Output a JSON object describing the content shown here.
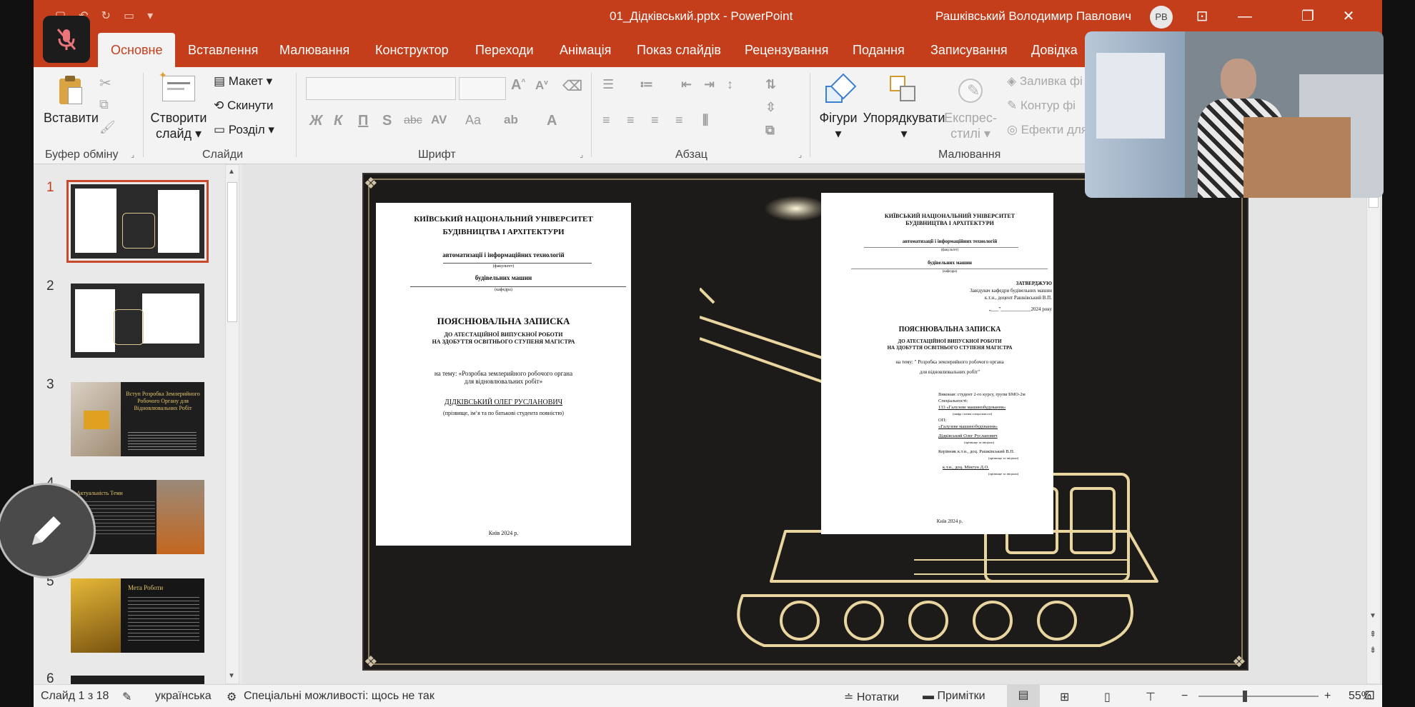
{
  "titlebar": {
    "doc_title": "01_Дідківський.pptx  -  PowerPoint",
    "user_name": "Рашківський Володимир Павлович",
    "user_initials": "PB"
  },
  "tabs": [
    "Основне",
    "Вставлення",
    "Малювання",
    "Конструктор",
    "Переходи",
    "Анімація",
    "Показ слайдів",
    "Рецензування",
    "Подання",
    "Записування",
    "Довідка"
  ],
  "ribbon": {
    "paste": "Вставити",
    "new_slide_1": "Створити",
    "new_slide_2": "слайд",
    "layout": "Макет",
    "reset": "Скинути",
    "section": "Розділ",
    "shapes": "Фігури",
    "arrange": "Упорядкувати",
    "express_1": "Експрес-",
    "express_2": "стилі",
    "fill": "Заливка фі",
    "outline": "Контур фі",
    "effects": "Ефекти для",
    "bold": "Ж",
    "italic": "К",
    "underline": "П",
    "strike": "S",
    "abc": "abc",
    "av": "AV",
    "aa": "Aa",
    "groups": {
      "clipboard": "Буфер обміну",
      "slides": "Слайди",
      "font": "Шрифт",
      "paragraph": "Абзац",
      "drawing": "Малювання"
    }
  },
  "thumbnails": [
    {
      "num": "1",
      "title": ""
    },
    {
      "num": "2",
      "title": ""
    },
    {
      "num": "3",
      "title": "Вступ Розробка Землерийного Робочого Органу для Відновлювальних Робіт"
    },
    {
      "num": "4",
      "title": "Актуальність Теми"
    },
    {
      "num": "5",
      "title": "Мета Роботи"
    },
    {
      "num": "6",
      "title": ""
    }
  ],
  "slide_left_page": {
    "uni_1": "КИЇВСЬКИЙ НАЦІОНАЛЬНИЙ УНІВЕРСИТЕТ",
    "uni_2": "БУДІВНИЦТВА І АРХІТЕКТУРИ",
    "faculty": "автоматизації і інформаційних технологій",
    "faculty_cap": "(факультет)",
    "dept": "будівельних машин",
    "dept_cap": "(кафедра)",
    "title": "ПОЯСНЮВАЛЬНА ЗАПИСКА",
    "sub_1": "ДО АТЕСТАЦІЙНОЇ ВИПУСКНОЇ РОБОТИ",
    "sub_2": "НА ЗДОБУТТЯ ОСВІТНЬОГО СТУПЕНЯ МАГІСТРА",
    "topic_1": "на тему: «Розробка землерийного робочого органа",
    "topic_2": "для відновлювальних робіт»",
    "author": "ДІДКІВСЬКИЙ ОЛЕГ РУСЛАНОВИЧ",
    "author_cap": "(прізвище, ім’я та по батькові студента повністю)",
    "footer": "Київ 2024 р."
  },
  "slide_right_page": {
    "uni_1": "КИЇВСЬКИЙ НАЦІОНАЛЬНИЙ УНІВЕРСИТЕТ",
    "uni_2": "БУДІВНИЦТВА І АРХІТЕКТУРИ",
    "faculty": "автоматизації і інформаційних технологій",
    "faculty_cap": "(факультет)",
    "dept": "будівельних машин",
    "dept_cap": "(кафедра)",
    "approve": "ЗАТВЕРДЖУЮ",
    "approve_2": "Завідувач кафедри будівельних машин",
    "approve_3": "к.т.н., доцент Рашківський В.П.",
    "approve_4": "„___”____________2024 року",
    "title": "ПОЯСНЮВАЛЬНА ЗАПИСКА",
    "sub_1": "ДО АТЕСТАЦІЙНОЇ ВИПУСКНОЇ РОБОТИ",
    "sub_2": "НА ЗДОБУТТЯ ОСВІТНЬОГО СТУПЕНЯ МАГІСТРА",
    "topic_1": "на тему: \" Розробка землерийного робочого органа",
    "topic_2": "для відновлювальних робіт\"",
    "r1": "Виконав: студент 2-го курсу, групи БМО-2м",
    "r2": "Спеціальності:",
    "r3": "133 «Галузеве машинобудування»",
    "r4": "(шифр і назва спеціальності)",
    "r5": "ОП:",
    "r6": "«Галузеве машинобудування»",
    "r7": "Дідківський Олег Русланович",
    "r8": "(прізвище та ініціали)",
    "r9": "Керівник     к.т.н., доц. Рашківський В.П.",
    "r10": "(прізвище та ініціали)",
    "r11": "к.т.н., доц. Мінгун Д.О.",
    "r12": "(прізвище та ініціали)",
    "footer": "Київ 2024 р."
  },
  "statusbar": {
    "slide_count": "Слайд 1 з 18",
    "language": "українська",
    "accessibility": "Спеціальні можливості: щось не так",
    "notes": "Нотатки",
    "comments": "Примітки",
    "zoom": "55%"
  },
  "colors": {
    "accent": "#c43e1c",
    "slide_bg": "#1d1b19",
    "gold": "#e8d5a0"
  }
}
